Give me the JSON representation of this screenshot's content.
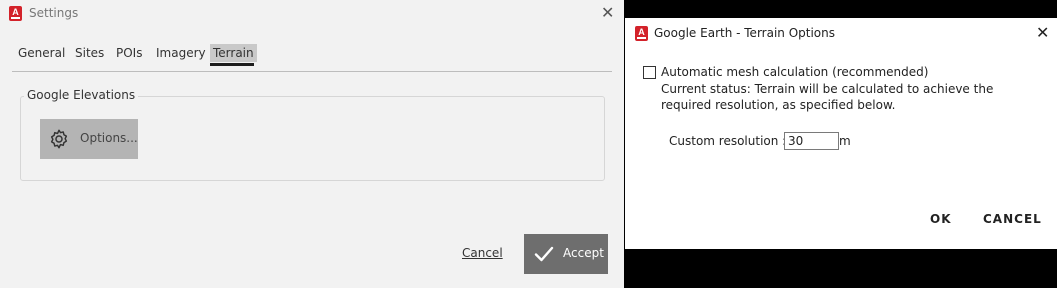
{
  "settings_window": {
    "title": "Settings",
    "app_icon_letter": "A",
    "close_glyph": "✕",
    "tabs": [
      {
        "label": "General",
        "active": false
      },
      {
        "label": "Sites",
        "active": false
      },
      {
        "label": "POIs",
        "active": false
      },
      {
        "label": "Imagery",
        "active": false
      },
      {
        "label": "Terrain",
        "active": true
      }
    ],
    "group": {
      "label": "Google Elevations",
      "options_button_label": "Options...",
      "options_icon": "gear-icon"
    },
    "footer": {
      "cancel_label": "Cancel",
      "accept_label": "Accept",
      "accept_icon": "checkmark-icon"
    }
  },
  "terrain_dialog": {
    "title": "Google Earth - Terrain Options",
    "app_icon_letter": "A",
    "close_glyph": "✕",
    "auto_mesh": {
      "label": "Automatic mesh calculation (recommended)",
      "checked": false
    },
    "status_text": "Current status: Terrain will be calculated to achieve the required resolution, as specified below.",
    "custom_resolution": {
      "label": "Custom resolution :",
      "value": "30",
      "unit": "m"
    },
    "ok_label": "OK",
    "cancel_label": "CANCEL"
  },
  "colors": {
    "app_icon": "#d3222a",
    "accept_button": "#6e6e6e",
    "options_button": "#b4b4b4",
    "active_tab_bg": "#c9c9c9"
  }
}
